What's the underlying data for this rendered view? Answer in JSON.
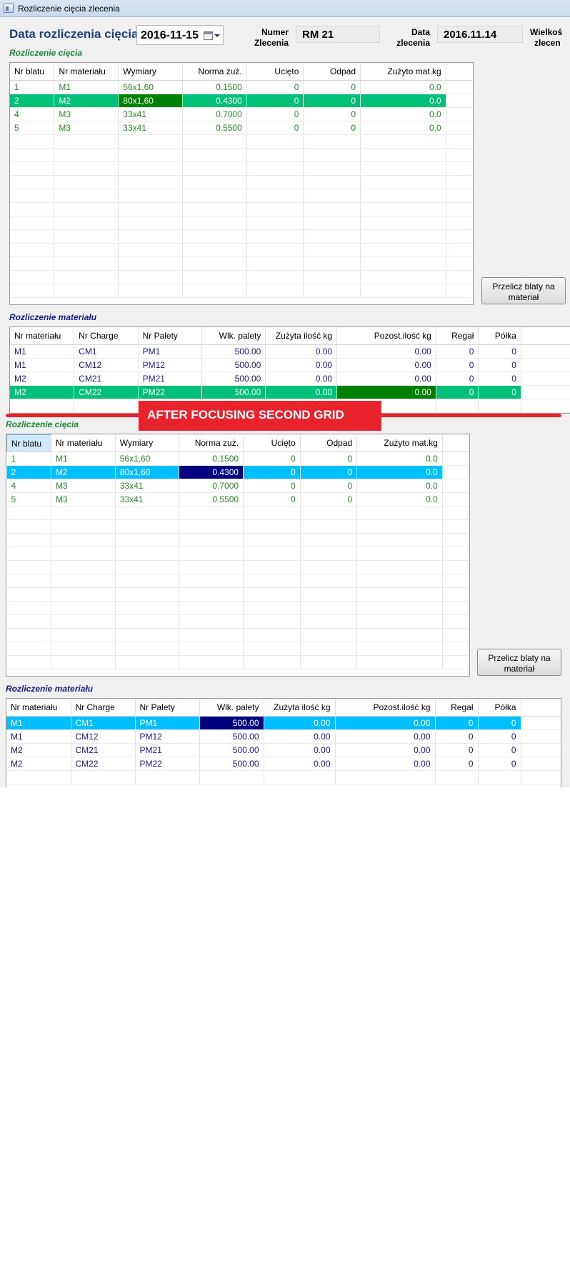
{
  "window": {
    "title": "Rozliczenie cięcia zlecenia"
  },
  "header": {
    "date_label": "Data rozliczenia cięcia",
    "date_value": "2016-11-15",
    "order_number_label_1": "Numer",
    "order_number_label_2": "Zlecenia",
    "order_number_value": "RM 21",
    "order_date_label_1": "Data",
    "order_date_label_2": "zlecenia",
    "order_date_value": "2016.11.14",
    "order_size_label_1": "Wielkoś",
    "order_size_label_2": "zlecen"
  },
  "cutting": {
    "title": "Rozliczenie cięcia",
    "columns": [
      "Nr blatu",
      "Nr materiału",
      "Wymiary",
      "Norma zuż.",
      "Ucięto",
      "Odpad",
      "Zużyto mat.kg"
    ],
    "rows": [
      [
        "1",
        "M1",
        "56x1,60",
        "0.1500",
        "0",
        "0",
        "0.0"
      ],
      [
        "2",
        "M2",
        "80x1,60",
        "0.4300",
        "0",
        "0",
        "0.0"
      ],
      [
        "4",
        "M3",
        "33x41",
        "0.7000",
        "0",
        "0",
        "0.0"
      ],
      [
        "5",
        "M3",
        "33x41",
        "0.5500",
        "0",
        "0",
        "0.0"
      ]
    ]
  },
  "materials": {
    "title": "Rozliczenie materiału",
    "columns": [
      "Nr materiału",
      "Nr Charge",
      "Nr Palety",
      "Wlk. palety",
      "Zużyta ilość kg",
      "Pozost.ilość kg",
      "Regał",
      "Półka"
    ],
    "rows": [
      [
        "M1",
        "CM1",
        "PM1",
        "500.00",
        "0.00",
        "0.00",
        "0",
        "0"
      ],
      [
        "M1",
        "CM12",
        "PM12",
        "500.00",
        "0.00",
        "0.00",
        "0",
        "0"
      ],
      [
        "M2",
        "CM21",
        "PM21",
        "500.00",
        "0.00",
        "0.00",
        "0",
        "0"
      ],
      [
        "M2",
        "CM22",
        "PM22",
        "500.00",
        "0.00",
        "0.00",
        "0",
        "0"
      ]
    ]
  },
  "recalc_button": {
    "label_1": "Przelicz blaty na",
    "label_2": "materiał"
  },
  "banner": {
    "text": "AFTER FOCUSING SECOND GRID"
  },
  "colors": {
    "selection_green": "#00c07a",
    "current_cell_dark_green": "#008000",
    "selection_cyan": "#00bfff",
    "current_cell_navy": "#000080",
    "banner_red": "#e8232d"
  }
}
